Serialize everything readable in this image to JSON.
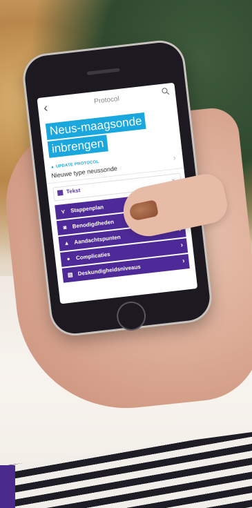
{
  "app": {
    "nav_title": "Protocol",
    "page_title_line1": "Neus-maagsonde",
    "page_title_line2": "inbrengen",
    "update_label": "UPDATE PROTOCOL",
    "update_text": "Nieuwe type neussonde",
    "tekst_label": "Tekst",
    "menu": [
      {
        "icon": "steps-icon",
        "glyph": "⋎",
        "label": "Stappenplan"
      },
      {
        "icon": "camera-icon",
        "glyph": "◙",
        "label": "Benodigdheden"
      },
      {
        "icon": "warning-icon",
        "glyph": "▲",
        "label": "Aandachtspunten"
      },
      {
        "icon": "speech-icon",
        "glyph": "●",
        "label": "Complicaties"
      },
      {
        "icon": "skill-icon",
        "glyph": "▤",
        "label": "Deskundigheidsniveaus"
      }
    ]
  },
  "colors": {
    "accent_blue": "#1aa7dd",
    "accent_purple": "#4e2a98"
  }
}
